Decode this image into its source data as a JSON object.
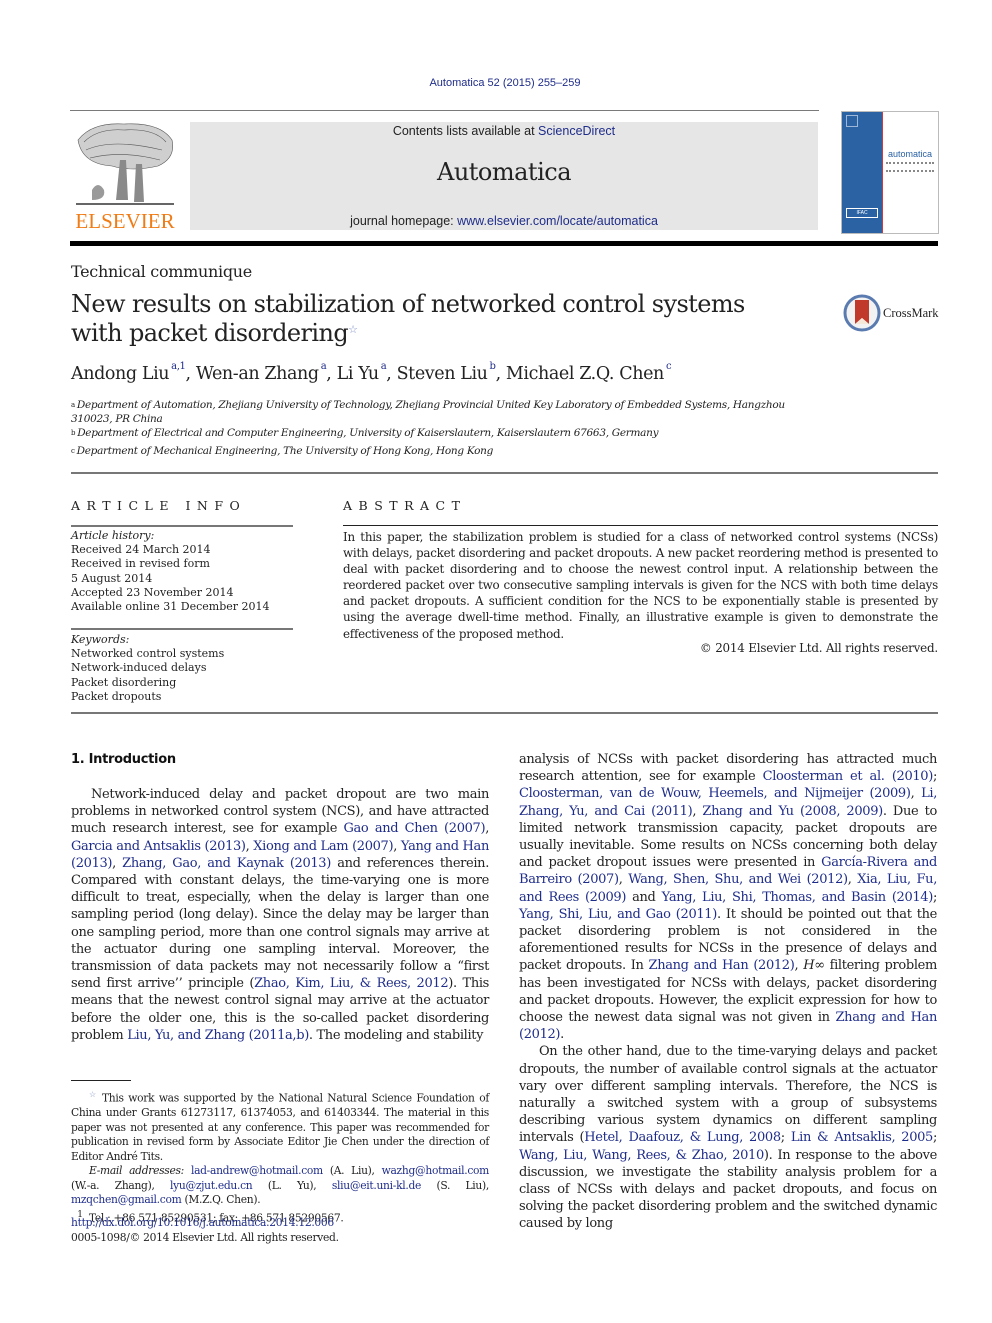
{
  "header": {
    "citation": "Automatica 52 (2015) 255–259",
    "contents_prefix": "Contents lists available at ",
    "contents_link": "ScienceDirect",
    "journal_title": "Automatica",
    "homepage_prefix": "journal homepage: ",
    "homepage_link": "www.elsevier.com/locate/automatica",
    "publisher_logo_text": "ELSEVIER",
    "cover_title": "automatica",
    "cover_badge": "IFAC"
  },
  "article": {
    "section_type": "Technical communique",
    "title": "New results on stabilization of networked control systems with packet disordering",
    "title_note_mark": "☆",
    "crossmark_label": "CrossMark",
    "authors": [
      {
        "name": "Andong Liu",
        "sup": "a,1"
      },
      {
        "name": "Wen-an Zhang",
        "sup": "a"
      },
      {
        "name": "Li Yu",
        "sup": "a"
      },
      {
        "name": "Steven Liu",
        "sup": "b"
      },
      {
        "name": "Michael Z.Q. Chen",
        "sup": "c"
      }
    ],
    "affiliations": [
      {
        "mark": "a",
        "text": "Department of Automation, Zhejiang University of Technology, Zhejiang Provincial United Key Laboratory of Embedded Systems, Hangzhou 310023, PR China"
      },
      {
        "mark": "b",
        "text": "Department of Electrical and Computer Engineering, University of Kaiserslautern, Kaiserslautern 67663, Germany"
      },
      {
        "mark": "c",
        "text": "Department of Mechanical Engineering, The University of Hong Kong, Hong Kong"
      }
    ]
  },
  "article_info": {
    "heading": "ARTICLE INFO",
    "history_label": "Article history:",
    "history": [
      "Received 24 March 2014",
      "Received in revised form",
      "5 August 2014",
      "Accepted 23 November 2014",
      "Available online 31 December 2014"
    ],
    "keywords_label": "Keywords:",
    "keywords": [
      "Networked control systems",
      "Network-induced delays",
      "Packet disordering",
      "Packet dropouts"
    ]
  },
  "abstract": {
    "heading": "ABSTRACT",
    "text": "In this paper, the stabilization problem is studied for a class of networked control systems (NCSs) with delays, packet disordering and packet dropouts. A new packet reordering method is presented to deal with packet disordering and to choose the newest control input. A relationship between the reordered packet over two consecutive sampling intervals is given for the NCS with both time delays and packet dropouts. A sufficient condition for the NCS to be exponentially stable is presented by using the average dwell-time method. Finally, an illustrative example is given to demonstrate the effectiveness of the proposed method.",
    "copyright": "© 2014 Elsevier Ltd. All rights reserved."
  },
  "body": {
    "section_heading": "1.  Introduction",
    "left_paragraph": [
      {
        "t": "Network-induced delay and packet dropout are two main problems in networked control system (NCS), and have attracted much research interest, see for example "
      },
      {
        "l": "Gao and Chen (2007)"
      },
      {
        "t": ", "
      },
      {
        "l": "Garcia and Antsaklis (2013)"
      },
      {
        "t": ", "
      },
      {
        "l": "Xiong and Lam (2007)"
      },
      {
        "t": ", "
      },
      {
        "l": "Yang and Han (2013)"
      },
      {
        "t": ", "
      },
      {
        "l": "Zhang, Gao, and Kaynak (2013)"
      },
      {
        "t": " and references therein. Compared with constant delays, the time-varying one is more difficult to treat, especially, when the delay is larger than one sampling period (long delay). Since the delay may be larger than one sampling period, more than one control signals may arrive at the actuator during one sampling interval. Moreover, the transmission of data packets may not necessarily follow a “first send first arrive’’ principle ("
      },
      {
        "l": "Zhao, Kim, Liu, & Rees, 2012"
      },
      {
        "t": "). This means that the newest control signal may arrive at the actuator before the older one, this is the so-called packet disordering problem "
      },
      {
        "l": "Liu, Yu, and Zhang (2011a,b)"
      },
      {
        "t": ". The modeling and stability"
      }
    ],
    "right_paragraph_1": [
      {
        "t": "analysis of NCSs with packet disordering has attracted much research attention, see for example "
      },
      {
        "l": "Cloosterman et al. (2010)"
      },
      {
        "t": "; "
      },
      {
        "l": "Cloosterman, van de Wouw, Heemels, and Nijmeijer (2009)"
      },
      {
        "t": ", "
      },
      {
        "l": "Li, Zhang, Yu, and Cai (2011)"
      },
      {
        "t": ", "
      },
      {
        "l": "Zhang and Yu (2008, 2009)"
      },
      {
        "t": ". Due to limited network transmission capacity, packet dropouts are usually inevitable. Some results on NCSs concerning both delay and packet dropout issues were presented in "
      },
      {
        "l": "García-Rivera and Barreiro (2007)"
      },
      {
        "t": ", "
      },
      {
        "l": "Wang, Shen, Shu, and Wei (2012)"
      },
      {
        "t": ", "
      },
      {
        "l": "Xia, Liu, Fu, and Rees (2009)"
      },
      {
        "t": " and "
      },
      {
        "l": "Yang, Liu, Shi, Thomas, and Basin (2014)"
      },
      {
        "t": "; "
      },
      {
        "l": "Yang, Shi, Liu, and Gao (2011)"
      },
      {
        "t": ". It should be pointed out that the packet disordering problem is not considered in the aforementioned results for NCSs in the presence of delays and packet dropouts. In "
      },
      {
        "l": "Zhang and Han (2012)"
      },
      {
        "t": ", "
      },
      {
        "m": "H∞"
      },
      {
        "t": " filtering problem has been investigated for NCSs with delays, packet disordering and packet dropouts. However, the explicit expression for how to choose the newest data signal was not given in "
      },
      {
        "l": "Zhang and Han (2012)"
      },
      {
        "t": "."
      }
    ],
    "right_paragraph_2": [
      {
        "t": "On the other hand, due to the time-varying delays and packet dropouts, the number of available control signals at the actuator vary over different sampling intervals. Therefore, the NCS is naturally a switched system with a group of subsystems describing various system dynamics on different sampling intervals ("
      },
      {
        "l": "Hetel, Daafouz, & Lung, 2008"
      },
      {
        "t": "; "
      },
      {
        "l": "Lin & Antsaklis, 2005"
      },
      {
        "t": "; "
      },
      {
        "l": "Wang, Liu, Wang, Rees, & Zhao, 2010"
      },
      {
        "t": "). In response to the above discussion, we investigate the stability analysis problem for a class of NCSs with delays and packet dropouts, and focus on solving the packet disordering problem and the switched dynamic caused by long"
      }
    ]
  },
  "footnotes": {
    "funding_mark": "☆",
    "funding": "This work was supported by the National Natural Science Foundation of China under Grants 61273117, 61374053, and 61403344. The material in this paper was not presented at any conference. This paper was recommended for publication in revised form by Associate Editor Jie Chen under the direction of Editor André Tits.",
    "email_label": "E-mail addresses:",
    "emails": [
      {
        "addr": "lad-andrew@hotmail.com",
        "who": " (A. Liu), "
      },
      {
        "addr": "wazhg@hotmail.com",
        "who": " (W.-a. Zhang), "
      },
      {
        "addr": "lyu@zjut.edu.cn",
        "who": " (L. Yu), "
      },
      {
        "addr": "sliu@eit.uni-kl.de",
        "who": " (S. Liu), "
      },
      {
        "addr": "mzqchen@gmail.com",
        "who": " (M.Z.Q. Chen)."
      }
    ],
    "tel_mark": "1",
    "tel": "Tel.: +86 571 85290531; fax: +86 571 85290567.",
    "doi": "http://dx.doi.org/10.1016/j.automatica.2014.12.006",
    "issn": "0005-1098/© 2014 Elsevier Ltd. All rights reserved."
  },
  "colors": {
    "link": "#1f2d8a",
    "publisher_orange": "#f07c16",
    "banner_bg": "#e6e6e6",
    "cover_blue": "#2a62a4"
  }
}
